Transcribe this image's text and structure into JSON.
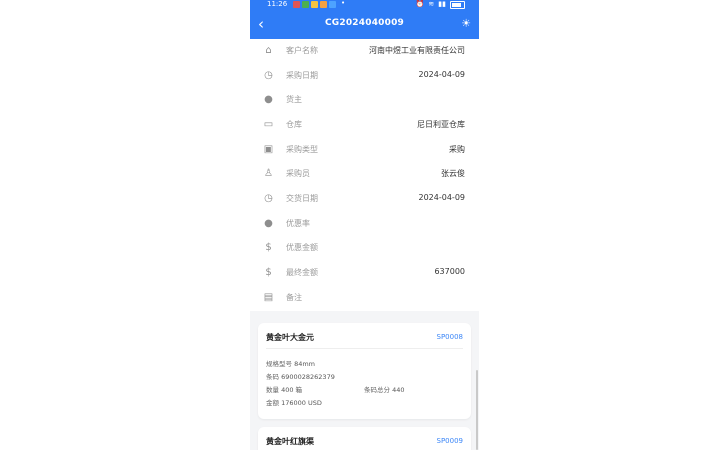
{
  "status_bar": {
    "time": "11:26",
    "dot": "•",
    "notification_colors": [
      "#e05555",
      "#4caf50",
      "#f5c542",
      "#f5a142",
      "#4da3ff"
    ]
  },
  "header": {
    "back_icon": "‹",
    "title": "CG2024040009",
    "theme_icon": "☀",
    "background_color": "#2f7cf6"
  },
  "info_rows": [
    {
      "icon": "home-icon",
      "label": "客户名称",
      "value": "河南中煜工业有限责任公司"
    },
    {
      "icon": "clock-icon",
      "label": "采购日期",
      "value": "2024-04-09"
    },
    {
      "icon": "user-circle-icon",
      "label": "货主",
      "value": ""
    },
    {
      "icon": "warehouse-icon",
      "label": "仓库",
      "value": "尼日利亚仓库"
    },
    {
      "icon": "image-icon",
      "label": "采购类型",
      "value": "采购"
    },
    {
      "icon": "person-icon",
      "label": "采购员",
      "value": "张云俊"
    },
    {
      "icon": "clock-icon",
      "label": "交货日期",
      "value": "2024-04-09"
    },
    {
      "icon": "user-circle-icon",
      "label": "优惠率",
      "value": ""
    },
    {
      "icon": "money-icon",
      "label": "优惠金额",
      "value": ""
    },
    {
      "icon": "money-icon",
      "label": "最终金额",
      "value": "637000"
    },
    {
      "icon": "comment-icon",
      "label": "备注",
      "value": ""
    }
  ],
  "products": [
    {
      "name": "黄金叶大金元",
      "code": "SP0008",
      "spec_label": "规格型号",
      "spec_value": "84mm",
      "barcode_label": "条码",
      "barcode_value": "6900028262379",
      "qty_label": "数量",
      "qty_value": "400 箱",
      "total_label": "条码总分",
      "total_value": "440",
      "amount_label": "金额",
      "amount_value": "176000 USD"
    },
    {
      "name": "黄金叶红旗渠",
      "code": "SP0009"
    }
  ]
}
